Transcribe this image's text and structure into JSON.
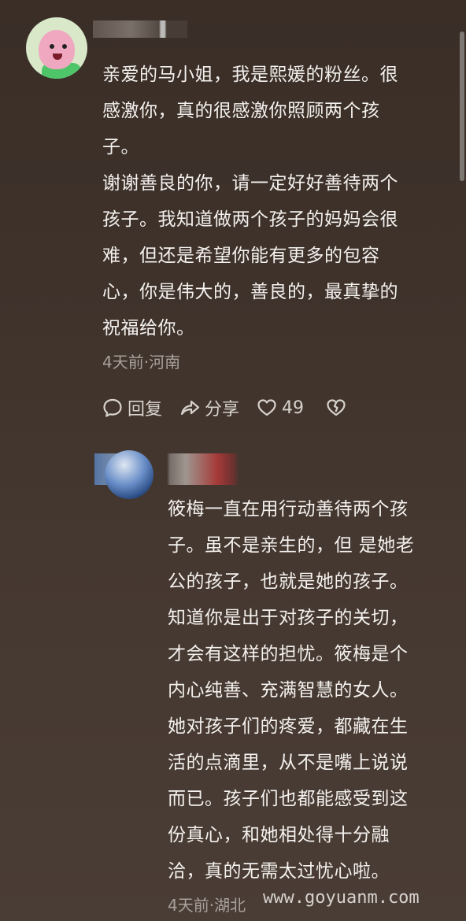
{
  "comment1": {
    "lines": [
      "亲爱的马小姐，我是熙媛的粉丝。很",
      "感激你，真的很感激你照顾两个孩",
      "子。",
      "谢谢善良的你，请一定好好善待两个",
      "孩子。我知道做两个孩子的妈妈会很",
      "难，但还是希望你能有更多的包容",
      "心，你是伟大的，善良的，最真挚的",
      "祝福给你。"
    ],
    "meta": "4天前·河南",
    "actions": {
      "reply": "回复",
      "share": "分享",
      "likes": "49"
    }
  },
  "comment2": {
    "lines": [
      "筱梅一直在用行动善待两个孩",
      "子。虽不是亲生的，但 是她老",
      "公的孩子，也就是她的孩子。",
      "知道你是出于对孩子的关切，",
      "才会有这样的担忧。筱梅是个",
      "内心纯善、充满智慧的女人。",
      "她对孩子们的疼爱，都藏在生",
      "活的点滴里，从不是嘴上说说",
      "而已。孩子们也都能感受到这",
      "份真心，和她相处得十分融",
      "洽，真的无需太过忧心啦。"
    ],
    "meta": "4天前·湖北"
  },
  "watermark": "www.goyuanm.com",
  "icons": {
    "reply": "comment-bubble-icon",
    "share": "share-arrow-icon",
    "like": "heart-icon",
    "dislike": "broken-heart-icon"
  }
}
